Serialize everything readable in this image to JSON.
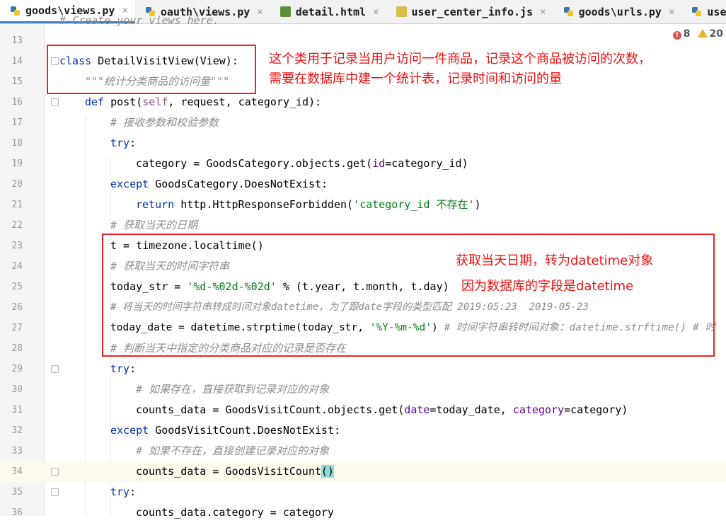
{
  "tabs": [
    {
      "label": "goods\\views.py",
      "icon": "python-file-icon",
      "active": true
    },
    {
      "label": "oauth\\views.py",
      "icon": "python-file-icon",
      "active": false
    },
    {
      "label": "detail.html",
      "icon": "html-file-icon",
      "active": false
    },
    {
      "label": "user_center_info.js",
      "icon": "js-file-icon",
      "active": false
    },
    {
      "label": "goods\\urls.py",
      "icon": "python-file-icon",
      "active": false
    },
    {
      "label": "user",
      "icon": "python-file-icon",
      "active": false
    }
  ],
  "close_glyph": "×",
  "inspections": {
    "errors": "8",
    "warnings": "20"
  },
  "partial_top_line": "# Create your views here.",
  "lines": [
    {
      "n": "13"
    },
    {
      "n": "14"
    },
    {
      "n": "15"
    },
    {
      "n": "16"
    },
    {
      "n": "17"
    },
    {
      "n": "18"
    },
    {
      "n": "19"
    },
    {
      "n": "20"
    },
    {
      "n": "21"
    },
    {
      "n": "22"
    },
    {
      "n": "23"
    },
    {
      "n": "24"
    },
    {
      "n": "25"
    },
    {
      "n": "26"
    },
    {
      "n": "27"
    },
    {
      "n": "28"
    },
    {
      "n": "29"
    },
    {
      "n": "30"
    },
    {
      "n": "31"
    },
    {
      "n": "32"
    },
    {
      "n": "33"
    },
    {
      "n": "34"
    },
    {
      "n": "35"
    },
    {
      "n": "36"
    }
  ],
  "code": {
    "l14_kw": "class",
    "l14_rest": " DetailVisitView(View):",
    "l15_doc": "\"\"\"统计分类商品的访问量\"\"\"",
    "l16_kw": "def",
    "l16_a": " post(",
    "l16_self": "self",
    "l16_b": ", request, category_id):",
    "l17_cmt": "# 接收参数和校验参数",
    "l18_kw": "try",
    "l18_b": ":",
    "l19_a": "category = GoodsCategory.objects.get(",
    "l19_param": "id",
    "l19_b": "=category_id)",
    "l20_kw": "except",
    "l20_b": " GoodsCategory.DoesNotExist:",
    "l21_kw": "return",
    "l21_a": " http.HttpResponseForbidden(",
    "l21_str": "'category_id 不存在'",
    "l21_b": ")",
    "l22_cmt": "# 获取当天的日期",
    "l23": "t = timezone.localtime()",
    "l24_cmt": "# 获取当天的时间字符串",
    "l25_a": "today_str = ",
    "l25_str": "'%d-%02d-%02d'",
    "l25_b": " % (t.year, t.month, t.day)",
    "l26_cmt": "# 将当天的时间字符串转成时间对象datetime，为了跟date字段的类型匹配 2019:05:23  2019-05-23",
    "l27_a": "today_date = datetime.strptime(today_str, ",
    "l27_str": "'%Y-%m-%d'",
    "l27_b": ") ",
    "l27_cmt": "# 时间字符串转时间对象：datetime.strftime() # 时",
    "l28_cmt": "# 判断当天中指定的分类商品对应的记录是否存在",
    "l29_kw": "try",
    "l29_b": ":",
    "l30_cmt": "# 如果存在，直接获取到记录对应的对象",
    "l31_a": "counts_data = GoodsVisitCount.objects.get(",
    "l31_p1": "date",
    "l31_b": "=today_date, ",
    "l31_p2": "category",
    "l31_c": "=category)",
    "l32_kw": "except",
    "l32_b": " GoodsVisitCount.DoesNotExist:",
    "l33_cmt": "# 如果不存在，直接创建记录对应的对象",
    "l34_a": "counts_data = GoodsVisitCount",
    "l34_br": "()",
    "l35_kw": "try",
    "l35_b": ":",
    "l36": "counts_data.category = category"
  },
  "annotations": {
    "a1_line1": "这个类用于记录当用户访问一件商品，记录这个商品被访问的次数，",
    "a1_line2": "需要在数据库中建一个统计表，记录时间和访问的量",
    "a2_line1": "获取当天日期，转为datetime对象",
    "a2_line2": "因为数据库的字段是datetime"
  },
  "colors": {
    "annotation": "#ee1111",
    "keyword": "#0033b3",
    "string": "#067d17",
    "comment": "#8c8c8c",
    "active_tab_underline": "#4083c9"
  }
}
